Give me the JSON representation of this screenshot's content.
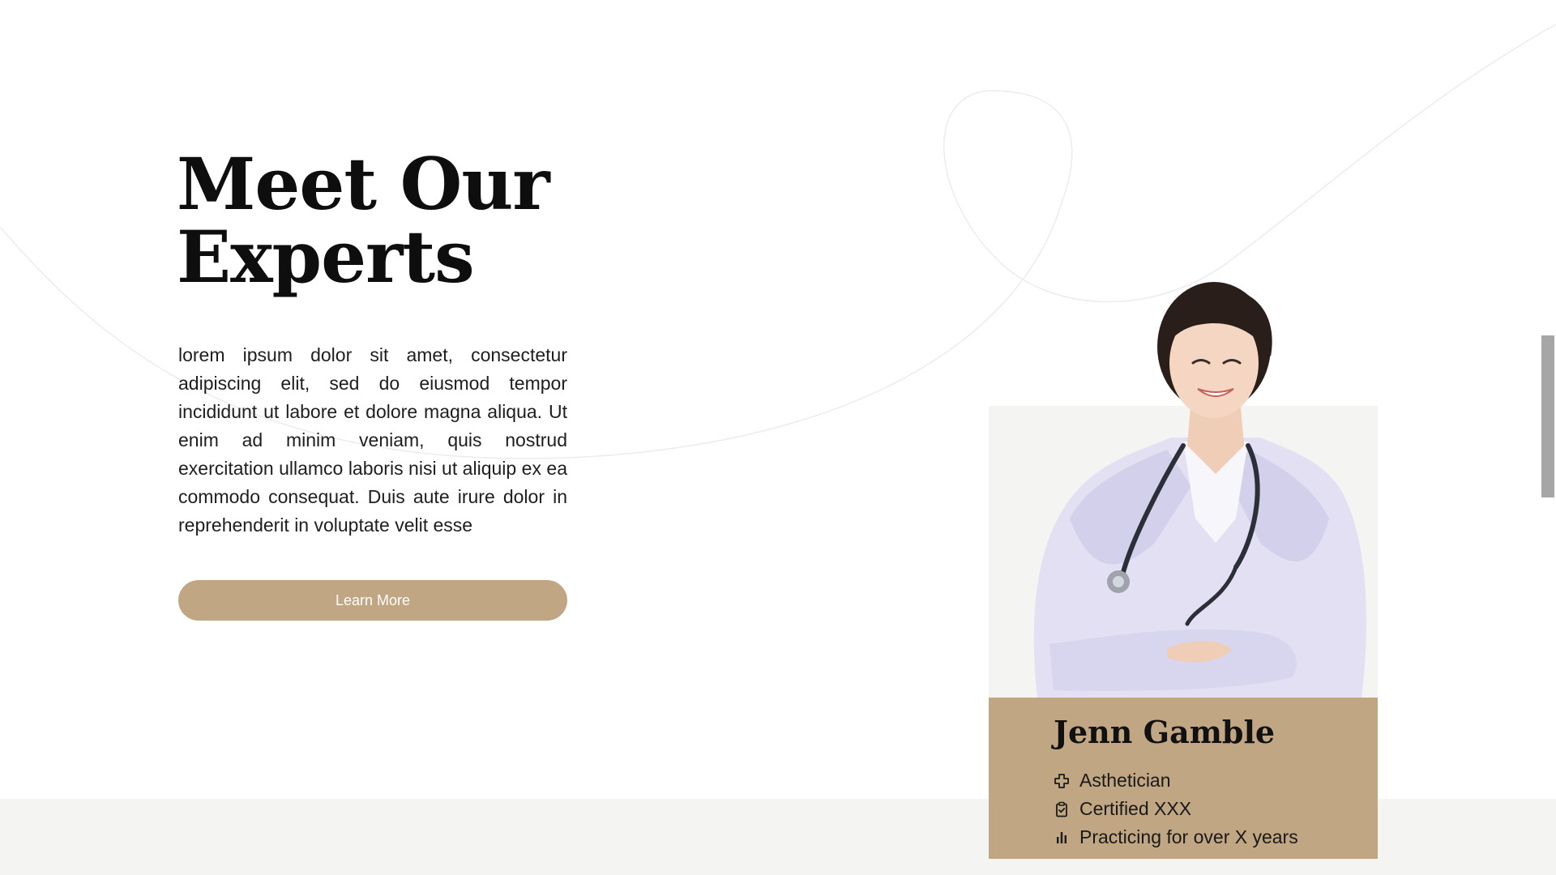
{
  "hero": {
    "title_line1": "Meet Our",
    "title_line2": "Experts",
    "body": "lorem ipsum dolor sit amet, consectetur adipiscing elit, sed do eiusmod tempor incididunt ut labore et dolore magna aliqua. Ut enim ad minim veniam, quis nostrud exercitation ullamco laboris nisi ut aliquip ex ea commodo consequat. Duis aute irure dolor in reprehenderit in voluptate velit esse",
    "button_label": "Learn More"
  },
  "expert": {
    "name": "Jenn Gamble",
    "details": [
      {
        "icon": "medical-cross-icon",
        "text": "Asthetician"
      },
      {
        "icon": "clipboard-check-icon",
        "text": "Certified XXX"
      },
      {
        "icon": "bar-chart-icon",
        "text": "Practicing for over X years"
      }
    ]
  },
  "colors": {
    "accent": "#c0a683",
    "photo_bg": "#f4f4f2",
    "band_bg": "#f4f4f2",
    "heading": "#0e0e0e",
    "body_text": "#1e1e1e"
  }
}
